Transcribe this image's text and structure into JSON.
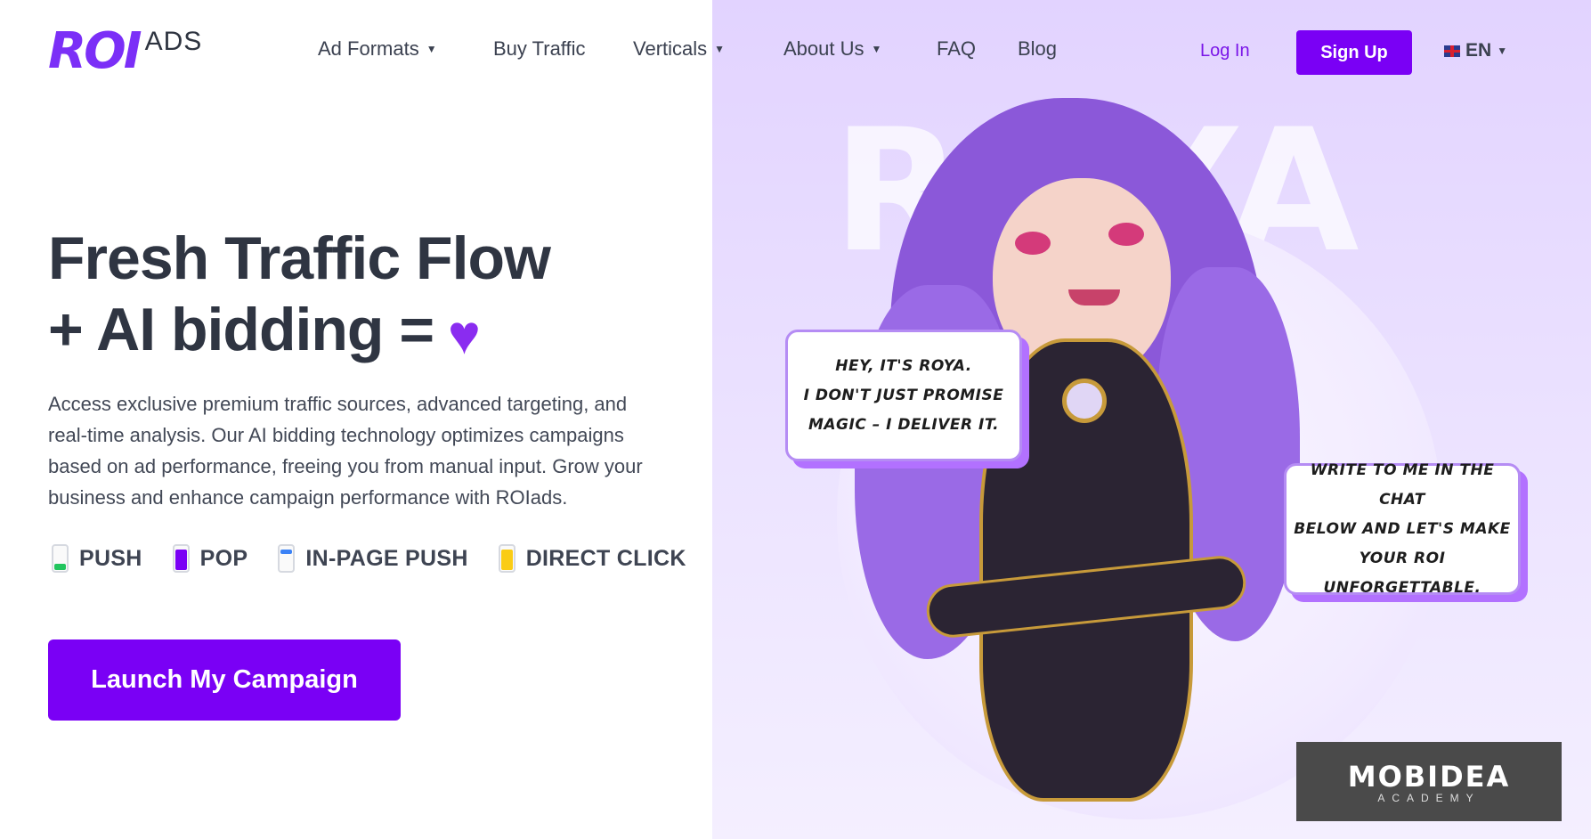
{
  "header": {
    "logo_mark": "ROI",
    "logo_ads": "ADS",
    "nav": [
      {
        "label": "Ad Formats",
        "has_dropdown": true
      },
      {
        "label": "Buy Traffic",
        "has_dropdown": false
      },
      {
        "label": "Verticals",
        "has_dropdown": true
      },
      {
        "label": "About Us",
        "has_dropdown": true
      },
      {
        "label": "FAQ",
        "has_dropdown": false
      },
      {
        "label": "Blog",
        "has_dropdown": false
      }
    ],
    "login_label": "Log In",
    "signup_label": "Sign Up",
    "language": "EN"
  },
  "hero": {
    "headline_line1": "Fresh Traffic Flow",
    "headline_line2": "+ AI bidding =",
    "description": "Access exclusive premium traffic sources, advanced targeting, and real-time analysis. Our AI bidding technology optimizes campaigns based on ad performance, freeing you from manual input. Grow your business and enhance campaign performance with ROIads.",
    "formats": [
      {
        "label": "PUSH",
        "icon": "push-phone-icon",
        "color": "#22c55e"
      },
      {
        "label": "POP",
        "icon": "pop-phone-icon",
        "color": "#7a00f5"
      },
      {
        "label": "IN-PAGE PUSH",
        "icon": "inpage-phone-icon",
        "color": "#3b82f6"
      },
      {
        "label": "DIRECT CLICK",
        "icon": "direct-click-phone-icon",
        "color": "#facc15"
      }
    ],
    "cta_label": "Launch My Campaign"
  },
  "illustration": {
    "watermark": "ROYA",
    "bubble1_lines": [
      "HEY, IT'S ROYA.",
      "I DON'T JUST PROMISE",
      "MAGIC – I DELIVER IT."
    ],
    "bubble2_lines": [
      "WRITE TO ME IN THE CHAT",
      "BELOW AND LET'S MAKE",
      "YOUR ROI UNFORGETTABLE."
    ]
  },
  "badge": {
    "name": "MOBIDEA",
    "sub": "ACADEMY"
  },
  "colors": {
    "brand": "#7a00f5",
    "text": "#2f3542",
    "hero_bg": "#e2d3ff"
  }
}
